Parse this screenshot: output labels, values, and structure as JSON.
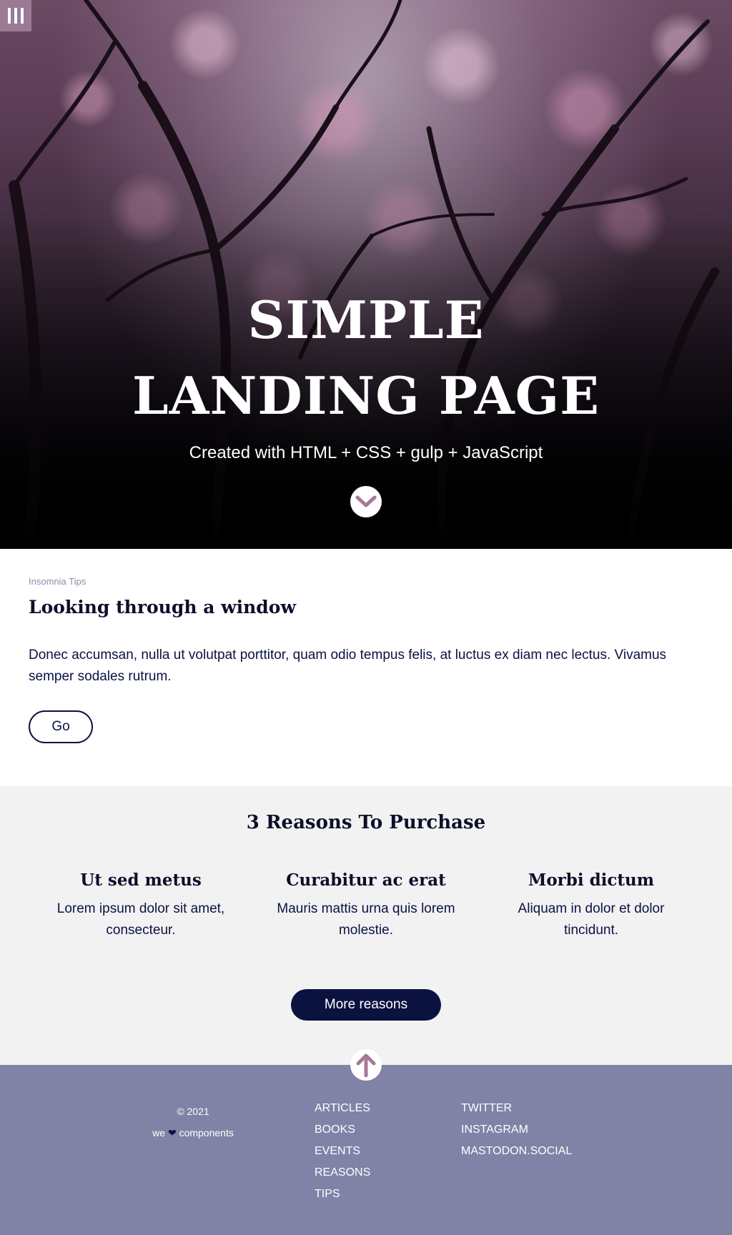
{
  "hero": {
    "menu_icon": "menu-bars-icon",
    "title_line1": "SIMPLE",
    "title_line2": "LANDING PAGE",
    "subtitle": "Created with HTML + CSS + gulp + JavaScript",
    "scroll_icon": "chevron-down-icon"
  },
  "tips": {
    "eyebrow": "Insomnia Tips",
    "heading": "Looking through a window",
    "body": "Donec accumsan, nulla ut volutpat porttitor, quam odio tempus felis, at luctus ex diam nec lectus. Vivamus semper sodales rutrum.",
    "button_label": "Go"
  },
  "reasons": {
    "heading": "3 Reasons To Purchase",
    "items": [
      {
        "title": "Ut sed metus",
        "text": "Lorem ipsum dolor sit amet, consecteur."
      },
      {
        "title": "Curabitur ac erat",
        "text": "Mauris mattis urna quis lorem molestie."
      },
      {
        "title": "Morbi dictum",
        "text": "Aliquam in dolor et dolor tincidunt."
      }
    ],
    "button_label": "More reasons"
  },
  "footer": {
    "back_to_top_icon": "arrow-up-icon",
    "copyright": "© 2021",
    "love_prefix": "we",
    "love_heart": "❤",
    "love_suffix": "components",
    "nav_links": [
      "ARTICLES",
      "BOOKS",
      "EVENTS",
      "REASONS",
      "TIPS"
    ],
    "social_links": [
      "TWITTER",
      "INSTAGRAM",
      "MASTODON.SOCIAL"
    ]
  },
  "colors": {
    "navy": "#0b1240",
    "menu_bg": "#9a7a95",
    "accent_pink": "#a97898",
    "footer_bg": "#8083a6",
    "reasons_bg": "#f2f2f2"
  }
}
